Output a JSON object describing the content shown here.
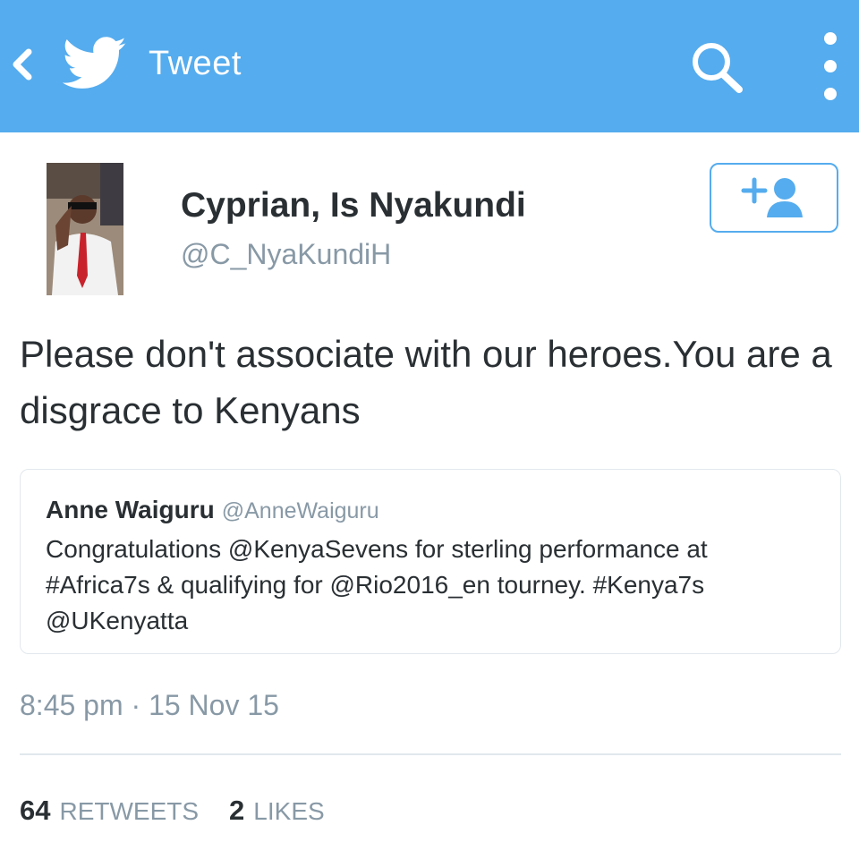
{
  "topbar": {
    "title": "Tweet",
    "back_icon": "chevron-left-icon",
    "logo_icon": "twitter-bird-icon",
    "search_icon": "search-icon",
    "more_icon": "more-vertical-icon",
    "color": "#55acee"
  },
  "tweet": {
    "author_name": "Cyprian, Is Nyakundi",
    "author_handle": "@C_NyaKundiH",
    "text": "Please don't associate with our heroes.You are a  disgrace to Kenyans",
    "follow_icon": "add-user-icon",
    "timestamp": "8:45 pm · 15 Nov 15"
  },
  "quoted_tweet": {
    "author_name": "Anne Waiguru",
    "author_handle": "@AnneWaiguru",
    "text": "Congratulations @KenyaSevens for sterling performance at #Africa7s & qualifying for @Rio2016_en tourney. #Kenya7s @UKenyatta"
  },
  "stats": {
    "retweets_count": "64",
    "retweets_label": "RETWEETS",
    "likes_count": "2",
    "likes_label": "LIKES"
  }
}
